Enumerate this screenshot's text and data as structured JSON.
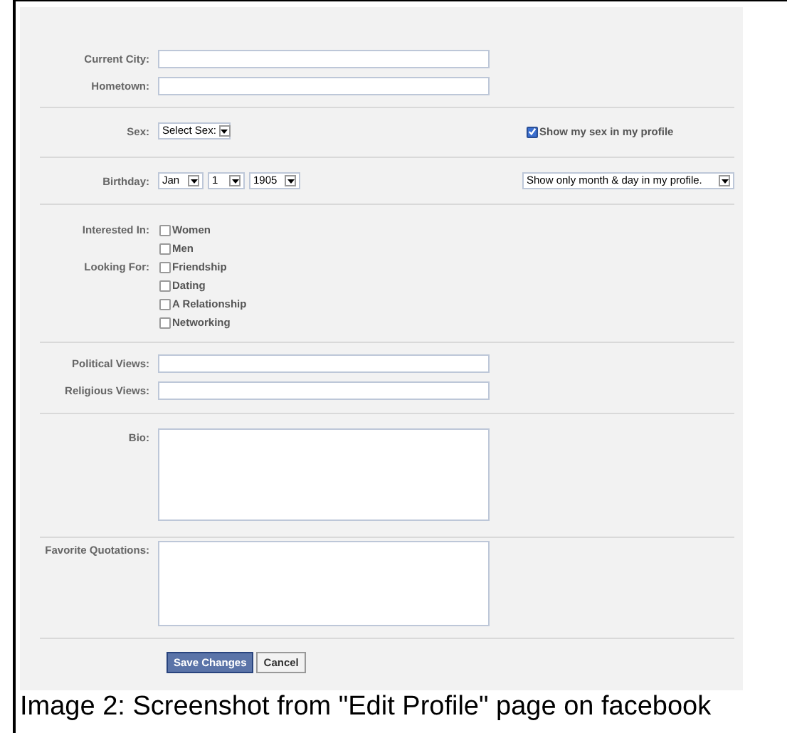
{
  "sections": [
    {
      "rows": [
        {
          "kind": "text",
          "label": "Current City:"
        },
        {
          "kind": "text",
          "label": "Hometown:"
        }
      ]
    },
    {
      "rows": [
        {
          "kind": "select",
          "label": "Sex:",
          "selects": [
            "Select Sex:"
          ],
          "option": {
            "label": "Show my sex in my profile",
            "checked": true
          }
        }
      ]
    },
    {
      "rows": [
        {
          "kind": "select",
          "label": "Birthday:",
          "selects": [
            "Jan",
            "1",
            "1905"
          ],
          "privacy": "Show only month & day in my profile."
        }
      ]
    },
    {
      "rows": [
        {
          "kind": "checks",
          "label": "Interested In:",
          "options": [
            {
              "label": "Women",
              "checked": false
            },
            {
              "label": "Men",
              "checked": false
            }
          ]
        },
        {
          "kind": "checks",
          "label": "Looking For:",
          "options": [
            {
              "label": "Friendship",
              "checked": false
            },
            {
              "label": "Dating",
              "checked": false
            },
            {
              "label": "A Relationship",
              "checked": false
            },
            {
              "label": "Networking",
              "checked": false
            }
          ]
        }
      ]
    },
    {
      "rows": [
        {
          "kind": "text",
          "label": "Political Views:"
        },
        {
          "kind": "text",
          "label": "Religious Views:"
        }
      ]
    },
    {
      "rows": [
        {
          "kind": "textarea",
          "label": "Bio:"
        }
      ]
    },
    {
      "rows": [
        {
          "kind": "textarea",
          "label": "Favorite Quotations:"
        }
      ]
    }
  ],
  "buttons": [
    {
      "label": "Save Changes",
      "kind": "primary"
    },
    {
      "label": "Cancel",
      "kind": "secondary"
    }
  ],
  "caption": "Image 2: Screenshot from \"Edit Profile\" page on facebook"
}
